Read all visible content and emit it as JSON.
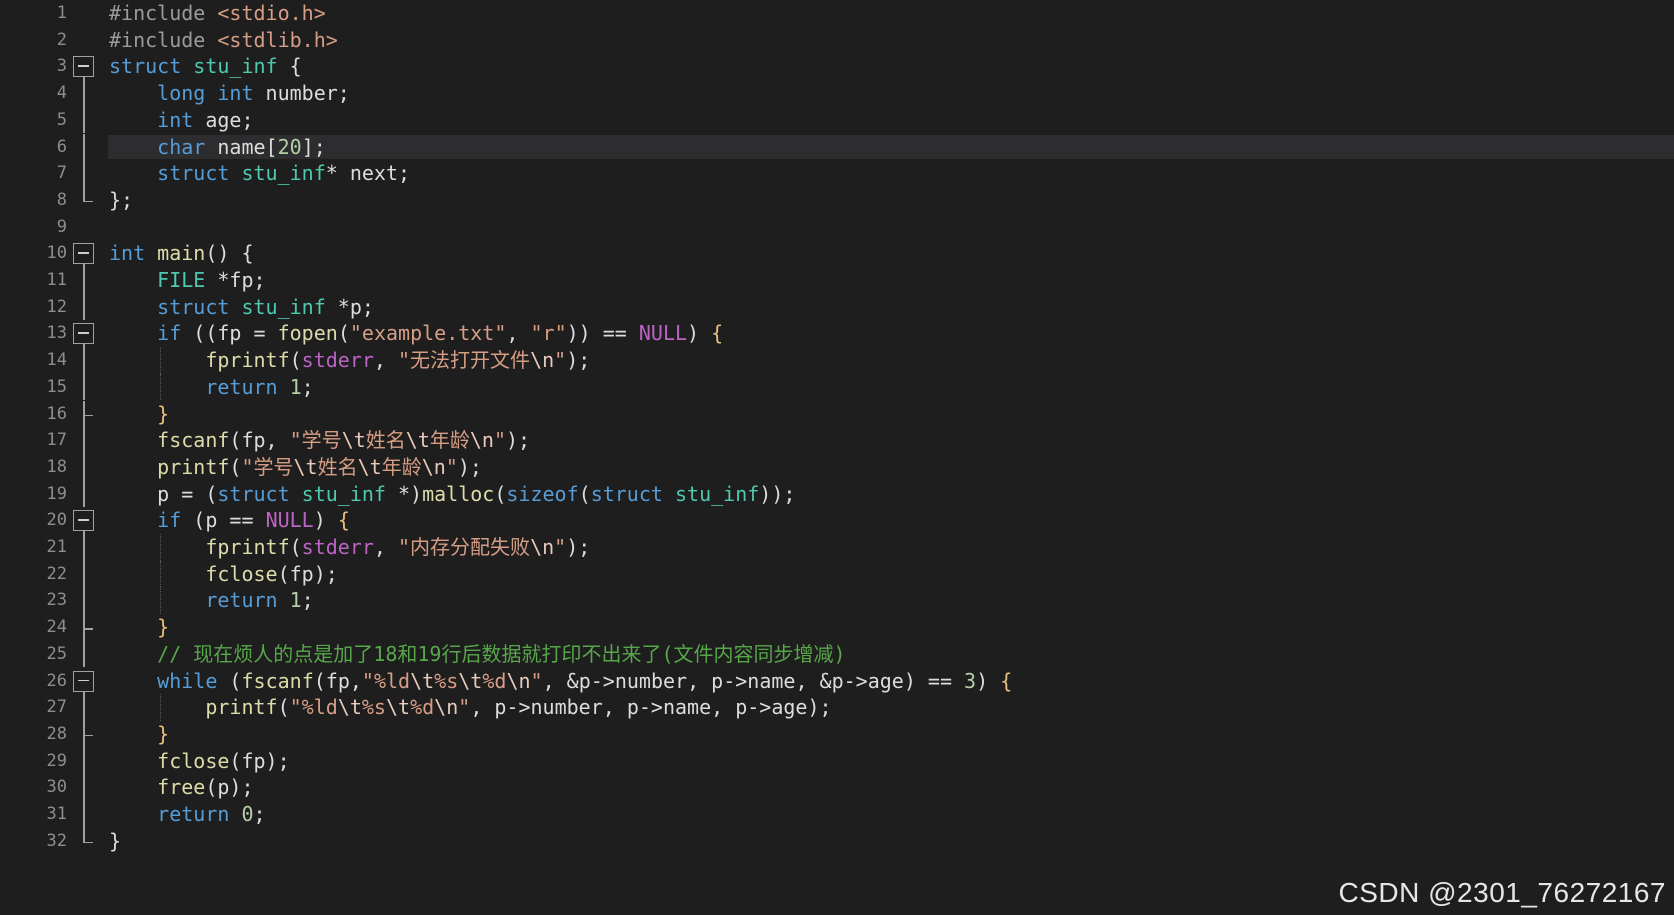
{
  "editor": {
    "highlighted_line": 6,
    "lines": [
      {
        "n": "1",
        "fold": "",
        "tokens": [
          {
            "t": "#include",
            "c": "pre"
          },
          {
            "t": " <stdio.h>",
            "c": "str"
          }
        ]
      },
      {
        "n": "2",
        "fold": "",
        "tokens": [
          {
            "t": "#include",
            "c": "pre"
          },
          {
            "t": " <stdlib.h>",
            "c": "str"
          }
        ]
      },
      {
        "n": "3",
        "fold": "open",
        "tokens": [
          {
            "t": "struct",
            "c": "kw"
          },
          {
            "t": " ",
            "c": "plain"
          },
          {
            "t": "stu_inf",
            "c": "type"
          },
          {
            "t": " {",
            "c": "plain"
          }
        ]
      },
      {
        "n": "4",
        "fold": "line",
        "tokens": [
          {
            "t": "    ",
            "c": "plain"
          },
          {
            "t": "long",
            "c": "kw"
          },
          {
            "t": " ",
            "c": "plain"
          },
          {
            "t": "int",
            "c": "kw"
          },
          {
            "t": " number;",
            "c": "plain"
          }
        ]
      },
      {
        "n": "5",
        "fold": "line",
        "tokens": [
          {
            "t": "    ",
            "c": "plain"
          },
          {
            "t": "int",
            "c": "kw"
          },
          {
            "t": " age;",
            "c": "plain"
          }
        ]
      },
      {
        "n": "6",
        "fold": "line",
        "tokens": [
          {
            "t": "    ",
            "c": "plain"
          },
          {
            "t": "char",
            "c": "kw"
          },
          {
            "t": " name[",
            "c": "plain"
          },
          {
            "t": "20",
            "c": "num"
          },
          {
            "t": "];",
            "c": "plain"
          }
        ]
      },
      {
        "n": "7",
        "fold": "line",
        "tokens": [
          {
            "t": "    ",
            "c": "plain"
          },
          {
            "t": "struct",
            "c": "kw"
          },
          {
            "t": " ",
            "c": "plain"
          },
          {
            "t": "stu_inf",
            "c": "type"
          },
          {
            "t": "* next;",
            "c": "plain"
          }
        ]
      },
      {
        "n": "8",
        "fold": "end",
        "tokens": [
          {
            "t": "};",
            "c": "plain"
          }
        ]
      },
      {
        "n": "9",
        "fold": "",
        "tokens": []
      },
      {
        "n": "10",
        "fold": "open",
        "tokens": [
          {
            "t": "int",
            "c": "kw"
          },
          {
            "t": " ",
            "c": "plain"
          },
          {
            "t": "main",
            "c": "fn"
          },
          {
            "t": "() {",
            "c": "plain"
          }
        ]
      },
      {
        "n": "11",
        "fold": "line",
        "tokens": [
          {
            "t": "    ",
            "c": "plain"
          },
          {
            "t": "FILE",
            "c": "type"
          },
          {
            "t": " *fp;",
            "c": "plain"
          }
        ]
      },
      {
        "n": "12",
        "fold": "line",
        "tokens": [
          {
            "t": "    ",
            "c": "plain"
          },
          {
            "t": "struct",
            "c": "kw"
          },
          {
            "t": " ",
            "c": "plain"
          },
          {
            "t": "stu_inf",
            "c": "type"
          },
          {
            "t": " *p;",
            "c": "plain"
          }
        ]
      },
      {
        "n": "13",
        "fold": "open",
        "tokens": [
          {
            "t": "    ",
            "c": "plain"
          },
          {
            "t": "if",
            "c": "ctl"
          },
          {
            "t": " ((fp = ",
            "c": "plain"
          },
          {
            "t": "fopen",
            "c": "fn"
          },
          {
            "t": "(",
            "c": "plain"
          },
          {
            "t": "\"example.txt\"",
            "c": "str"
          },
          {
            "t": ", ",
            "c": "plain"
          },
          {
            "t": "\"r\"",
            "c": "str"
          },
          {
            "t": ")) == ",
            "c": "plain"
          },
          {
            "t": "NULL",
            "c": "macro"
          },
          {
            "t": ") ",
            "c": "plain"
          },
          {
            "t": "{",
            "c": "brace"
          }
        ]
      },
      {
        "n": "14",
        "fold": "line",
        "guide": true,
        "tokens": [
          {
            "t": "        ",
            "c": "plain"
          },
          {
            "t": "fprintf",
            "c": "fn"
          },
          {
            "t": "(",
            "c": "plain"
          },
          {
            "t": "stderr",
            "c": "macro"
          },
          {
            "t": ", ",
            "c": "plain"
          },
          {
            "t": "\"无法打开文件",
            "c": "str"
          },
          {
            "t": "\\n",
            "c": "esc"
          },
          {
            "t": "\"",
            "c": "str"
          },
          {
            "t": ");",
            "c": "plain"
          }
        ]
      },
      {
        "n": "15",
        "fold": "line",
        "guide": true,
        "tokens": [
          {
            "t": "        ",
            "c": "plain"
          },
          {
            "t": "return",
            "c": "ctl"
          },
          {
            "t": " ",
            "c": "plain"
          },
          {
            "t": "1",
            "c": "num"
          },
          {
            "t": ";",
            "c": "plain"
          }
        ]
      },
      {
        "n": "16",
        "fold": "end-inner",
        "tokens": [
          {
            "t": "    ",
            "c": "plain"
          },
          {
            "t": "}",
            "c": "brace"
          }
        ]
      },
      {
        "n": "17",
        "fold": "line",
        "tokens": [
          {
            "t": "    ",
            "c": "plain"
          },
          {
            "t": "fscanf",
            "c": "fn"
          },
          {
            "t": "(fp, ",
            "c": "plain"
          },
          {
            "t": "\"学号",
            "c": "str"
          },
          {
            "t": "\\t",
            "c": "esc"
          },
          {
            "t": "姓名",
            "c": "str"
          },
          {
            "t": "\\t",
            "c": "esc"
          },
          {
            "t": "年龄",
            "c": "str"
          },
          {
            "t": "\\n",
            "c": "esc"
          },
          {
            "t": "\"",
            "c": "str"
          },
          {
            "t": ");",
            "c": "plain"
          }
        ]
      },
      {
        "n": "18",
        "fold": "line",
        "tokens": [
          {
            "t": "    ",
            "c": "plain"
          },
          {
            "t": "printf",
            "c": "fn"
          },
          {
            "t": "(",
            "c": "plain"
          },
          {
            "t": "\"学号",
            "c": "str"
          },
          {
            "t": "\\t",
            "c": "esc"
          },
          {
            "t": "姓名",
            "c": "str"
          },
          {
            "t": "\\t",
            "c": "esc"
          },
          {
            "t": "年龄",
            "c": "str"
          },
          {
            "t": "\\n",
            "c": "esc"
          },
          {
            "t": "\"",
            "c": "str"
          },
          {
            "t": ");",
            "c": "plain"
          }
        ]
      },
      {
        "n": "19",
        "fold": "line",
        "tokens": [
          {
            "t": "    p = (",
            "c": "plain"
          },
          {
            "t": "struct",
            "c": "kw"
          },
          {
            "t": " ",
            "c": "plain"
          },
          {
            "t": "stu_inf",
            "c": "type"
          },
          {
            "t": " *)",
            "c": "plain"
          },
          {
            "t": "malloc",
            "c": "fn"
          },
          {
            "t": "(",
            "c": "plain"
          },
          {
            "t": "sizeof",
            "c": "kw"
          },
          {
            "t": "(",
            "c": "plain"
          },
          {
            "t": "struct",
            "c": "kw"
          },
          {
            "t": " ",
            "c": "plain"
          },
          {
            "t": "stu_inf",
            "c": "type"
          },
          {
            "t": "));",
            "c": "plain"
          }
        ]
      },
      {
        "n": "20",
        "fold": "open",
        "tokens": [
          {
            "t": "    ",
            "c": "plain"
          },
          {
            "t": "if",
            "c": "ctl"
          },
          {
            "t": " (p == ",
            "c": "plain"
          },
          {
            "t": "NULL",
            "c": "macro"
          },
          {
            "t": ") ",
            "c": "plain"
          },
          {
            "t": "{",
            "c": "brace"
          }
        ]
      },
      {
        "n": "21",
        "fold": "line",
        "guide": true,
        "tokens": [
          {
            "t": "        ",
            "c": "plain"
          },
          {
            "t": "fprintf",
            "c": "fn"
          },
          {
            "t": "(",
            "c": "plain"
          },
          {
            "t": "stderr",
            "c": "macro"
          },
          {
            "t": ", ",
            "c": "plain"
          },
          {
            "t": "\"内存分配失败",
            "c": "str"
          },
          {
            "t": "\\n",
            "c": "esc"
          },
          {
            "t": "\"",
            "c": "str"
          },
          {
            "t": ");",
            "c": "plain"
          }
        ]
      },
      {
        "n": "22",
        "fold": "line",
        "guide": true,
        "tokens": [
          {
            "t": "        ",
            "c": "plain"
          },
          {
            "t": "fclose",
            "c": "fn"
          },
          {
            "t": "(fp);",
            "c": "plain"
          }
        ]
      },
      {
        "n": "23",
        "fold": "line",
        "guide": true,
        "tokens": [
          {
            "t": "        ",
            "c": "plain"
          },
          {
            "t": "return",
            "c": "ctl"
          },
          {
            "t": " ",
            "c": "plain"
          },
          {
            "t": "1",
            "c": "num"
          },
          {
            "t": ";",
            "c": "plain"
          }
        ]
      },
      {
        "n": "24",
        "fold": "end-inner",
        "tokens": [
          {
            "t": "    ",
            "c": "plain"
          },
          {
            "t": "}",
            "c": "brace"
          }
        ]
      },
      {
        "n": "25",
        "fold": "line",
        "tokens": [
          {
            "t": "    ",
            "c": "plain"
          },
          {
            "t": "// 现在烦人的点是加了18和19行后数据就打印不出来了(文件内容同步增减)",
            "c": "cmt"
          }
        ]
      },
      {
        "n": "26",
        "fold": "open",
        "tokens": [
          {
            "t": "    ",
            "c": "plain"
          },
          {
            "t": "while",
            "c": "ctl"
          },
          {
            "t": " (",
            "c": "plain"
          },
          {
            "t": "fscanf",
            "c": "fn"
          },
          {
            "t": "(fp,",
            "c": "plain"
          },
          {
            "t": "\"%ld",
            "c": "str"
          },
          {
            "t": "\\t",
            "c": "esc"
          },
          {
            "t": "%s",
            "c": "str"
          },
          {
            "t": "\\t",
            "c": "esc"
          },
          {
            "t": "%d",
            "c": "str"
          },
          {
            "t": "\\n",
            "c": "esc"
          },
          {
            "t": "\"",
            "c": "str"
          },
          {
            "t": ", &p->number, ",
            "c": "plain"
          },
          {
            "t": "p->name, &p->age",
            "c": "plain"
          },
          {
            "t": ") == ",
            "c": "plain"
          },
          {
            "t": "3",
            "c": "num"
          },
          {
            "t": ") ",
            "c": "plain"
          },
          {
            "t": "{",
            "c": "brace"
          }
        ]
      },
      {
        "n": "27",
        "fold": "line",
        "guide": true,
        "tokens": [
          {
            "t": "        ",
            "c": "plain"
          },
          {
            "t": "printf",
            "c": "fn"
          },
          {
            "t": "(",
            "c": "plain"
          },
          {
            "t": "\"%ld",
            "c": "str"
          },
          {
            "t": "\\t",
            "c": "esc"
          },
          {
            "t": "%s",
            "c": "str"
          },
          {
            "t": "\\t",
            "c": "esc"
          },
          {
            "t": "%d",
            "c": "str"
          },
          {
            "t": "\\n",
            "c": "esc"
          },
          {
            "t": "\"",
            "c": "str"
          },
          {
            "t": ", p->number, p->name, p->age);",
            "c": "plain"
          }
        ]
      },
      {
        "n": "28",
        "fold": "end-inner",
        "tokens": [
          {
            "t": "    ",
            "c": "plain"
          },
          {
            "t": "}",
            "c": "brace"
          }
        ]
      },
      {
        "n": "29",
        "fold": "line",
        "tokens": [
          {
            "t": "    ",
            "c": "plain"
          },
          {
            "t": "fclose",
            "c": "fn"
          },
          {
            "t": "(fp);",
            "c": "plain"
          }
        ]
      },
      {
        "n": "30",
        "fold": "line",
        "tokens": [
          {
            "t": "    ",
            "c": "plain"
          },
          {
            "t": "free",
            "c": "fn"
          },
          {
            "t": "(p);",
            "c": "plain"
          }
        ]
      },
      {
        "n": "31",
        "fold": "line",
        "tokens": [
          {
            "t": "    ",
            "c": "plain"
          },
          {
            "t": "return",
            "c": "ctl"
          },
          {
            "t": " ",
            "c": "plain"
          },
          {
            "t": "0",
            "c": "num"
          },
          {
            "t": ";",
            "c": "plain"
          }
        ]
      },
      {
        "n": "32",
        "fold": "end",
        "tokens": [
          {
            "t": "}",
            "c": "plain"
          }
        ]
      }
    ]
  },
  "watermark": {
    "text": "CSDN @2301_76272167"
  },
  "colors": {
    "background": "#1e1e1e",
    "keyword": "#569cd6",
    "type": "#4ec9b0",
    "function": "#dcdcaa",
    "string": "#d69d85",
    "number": "#b5cea8",
    "macro": "#bd63c5",
    "comment": "#57a64a",
    "line_number": "#8e8e8e"
  }
}
